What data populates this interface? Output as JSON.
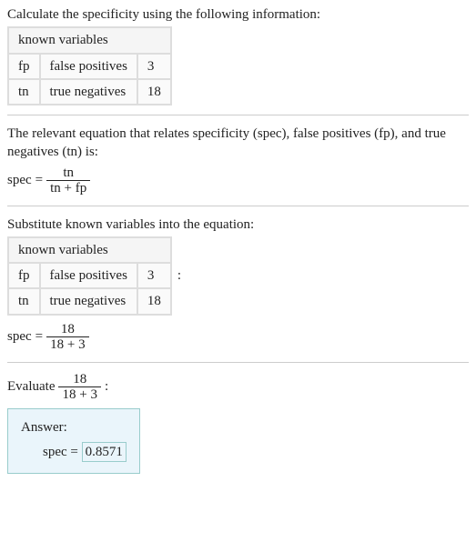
{
  "intro": "Calculate the specificity using the following information:",
  "table1": {
    "header": "known variables",
    "rows": [
      {
        "sym": "fp",
        "name": "false positives",
        "val": "3"
      },
      {
        "sym": "tn",
        "name": "true negatives",
        "val": "18"
      }
    ]
  },
  "relevant_eq_text": "The relevant equation that relates specificity (spec), false positives (fp), and true negatives (tn) is:",
  "eq1": {
    "lhs": "spec",
    "eq": "=",
    "num": "tn",
    "den": "tn + fp"
  },
  "substitute_text": "Substitute known variables into the equation:",
  "table2": {
    "header": "known variables",
    "rows": [
      {
        "sym": "fp",
        "name": "false positives",
        "val": "3"
      },
      {
        "sym": "tn",
        "name": "true negatives",
        "val": "18"
      }
    ]
  },
  "colon": ":",
  "eq2": {
    "lhs": "spec",
    "eq": "=",
    "num": "18",
    "den": "18 + 3"
  },
  "evaluate": {
    "pre": "Evaluate",
    "num": "18",
    "den": "18 + 3",
    "post": ":"
  },
  "answer": {
    "label": "Answer:",
    "lhs": "spec",
    "eq": "=",
    "val": "0.8571"
  },
  "chart_data": {
    "type": "table",
    "title": "Specificity calculation",
    "inputs": {
      "false_positives": 3,
      "true_negatives": 18
    },
    "formula": "spec = tn / (tn + fp)",
    "result": 0.8571
  }
}
